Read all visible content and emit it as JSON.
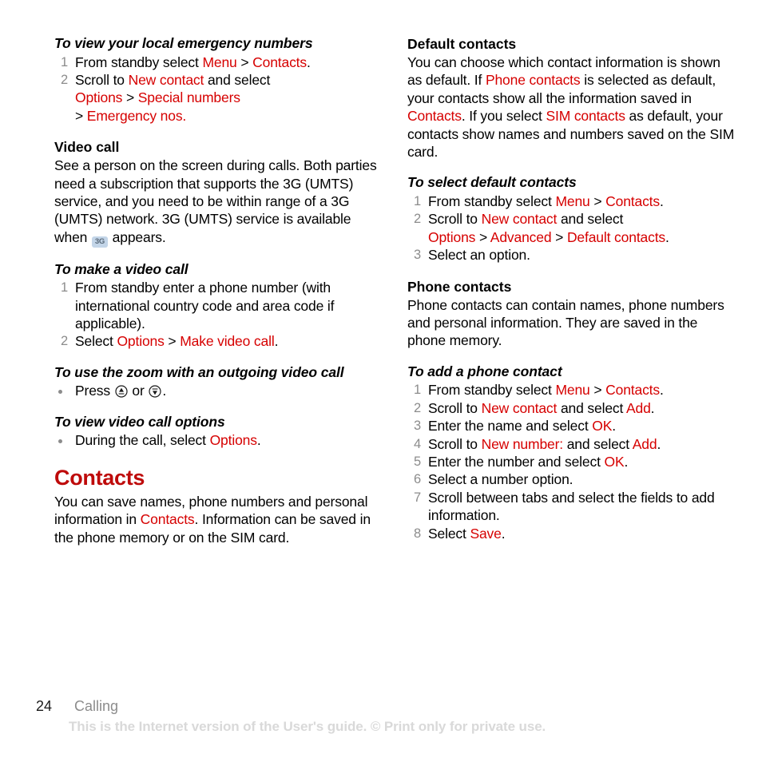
{
  "document": {
    "page_number": "24",
    "section_name": "Calling",
    "watermark": "This is the Internet version of the User's guide. © Print only for private use.",
    "colors": {
      "ui_term_red": "#D60000",
      "chapter_red": "#BE0A0A",
      "step_number_grey": "#8C8C8C",
      "watermark_grey": "#D9D9D9"
    }
  },
  "left_column": {
    "emergency": {
      "heading": "To view your local emergency numbers",
      "step1": {
        "num": "1",
        "t1": "From standby select ",
        "ui1": "Menu",
        "sep1": " > ",
        "ui2": "Contacts",
        "t2": "."
      },
      "step2": {
        "num": "2",
        "t1": "Scroll to ",
        "ui1": "New contact",
        "t2": " and select",
        "ui2": "Options",
        "sep1": " > ",
        "ui3": "Special numbers",
        "sep2": "> ",
        "ui4": "Emergency nos.",
        "t3": ""
      }
    },
    "video_call": {
      "heading": "Video call",
      "body_part1": "See a person on the screen during calls. Both parties need a subscription that supports the 3G (UMTS) service, and you need to be within range of a 3G (UMTS) network. 3G (UMTS) service is available when ",
      "icon_label": "3G",
      "body_part2": " appears."
    },
    "make_video_call": {
      "heading": "To make a video call",
      "step1": {
        "num": "1",
        "t1": "From standby enter a phone number (with international country code and area code if applicable)."
      },
      "step2": {
        "num": "2",
        "t1": "Select ",
        "ui1": "Options",
        "sep1": " > ",
        "ui2": "Make video call",
        "t2": "."
      }
    },
    "zoom_video_call": {
      "heading": "To use the zoom with an outgoing video call",
      "bullet": {
        "t1": "Press ",
        "t2": " or ",
        "t3": "."
      }
    },
    "video_call_options": {
      "heading": "To view video call options",
      "bullet": {
        "t1": "During the call, select ",
        "ui1": "Options",
        "t2": "."
      }
    },
    "contacts_chapter": {
      "heading": "Contacts",
      "body_part1": "You can save names, phone numbers and personal information in ",
      "ui1": "Contacts",
      "body_part2": ". Information can be saved in the phone memory or on the SIM card."
    }
  },
  "right_column": {
    "default_contacts": {
      "heading": "Default contacts",
      "p1": "You can choose which contact information is shown as default. If ",
      "ui1": "Phone contacts",
      "p2": " is selected as default, your contacts show all the information saved in ",
      "ui2": "Contacts",
      "p3": ". If you select ",
      "ui3": "SIM contacts",
      "p4": " as default, your contacts show names and numbers saved on the SIM card."
    },
    "select_default_contacts": {
      "heading": "To select default contacts",
      "step1": {
        "num": "1",
        "t1": "From standby select ",
        "ui1": "Menu",
        "sep1": " > ",
        "ui2": "Contacts",
        "t2": "."
      },
      "step2": {
        "num": "2",
        "t1": "Scroll to ",
        "ui1": "New contact",
        "t2": " and select",
        "ui2": "Options",
        "sep1": " > ",
        "ui3": "Advanced",
        "sep2": " > ",
        "ui4": "Default contacts",
        "t3": "."
      },
      "step3": {
        "num": "3",
        "t1": "Select an option."
      }
    },
    "phone_contacts": {
      "heading": "Phone contacts",
      "body": "Phone contacts can contain names, phone numbers and personal information. They are saved in the phone memory."
    },
    "add_phone_contact": {
      "heading": "To add a phone contact",
      "step1": {
        "num": "1",
        "t1": "From standby select ",
        "ui1": "Menu",
        "sep1": " > ",
        "ui2": "Contacts",
        "t2": "."
      },
      "step2": {
        "num": "2",
        "t1": "Scroll to ",
        "ui1": "New contact",
        "t2": " and select ",
        "ui2": "Add",
        "t3": "."
      },
      "step3": {
        "num": "3",
        "t1": "Enter the name and select ",
        "ui1": "OK",
        "t2": "."
      },
      "step4": {
        "num": "4",
        "t1": "Scroll to ",
        "ui1": "New number:",
        "t2": " and select ",
        "ui2": "Add",
        "t3": "."
      },
      "step5": {
        "num": "5",
        "t1": "Enter the number and select ",
        "ui1": "OK",
        "t2": "."
      },
      "step6": {
        "num": "6",
        "t1": "Select a number option."
      },
      "step7": {
        "num": "7",
        "t1": "Scroll between tabs and select the fields to add information."
      },
      "step8": {
        "num": "8",
        "t1": "Select ",
        "ui1": "Save",
        "t2": "."
      }
    }
  }
}
